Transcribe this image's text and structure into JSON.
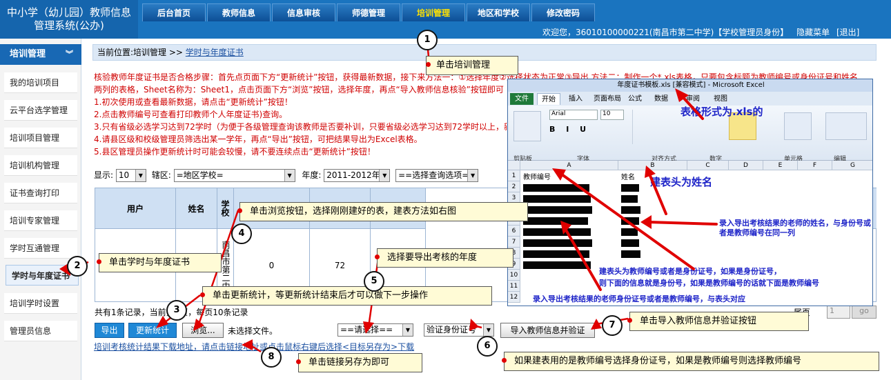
{
  "app": {
    "title_line1": "中小学（幼儿园）教师信息",
    "title_line2": "管理系统(公办)"
  },
  "nav": {
    "tabs": [
      {
        "label": "后台首页"
      },
      {
        "label": "教师信息"
      },
      {
        "label": "信息审核"
      },
      {
        "label": "师德管理"
      },
      {
        "label": "培训管理",
        "active": true
      },
      {
        "label": "地区和学校"
      },
      {
        "label": "修改密码"
      }
    ]
  },
  "welcome": {
    "text": "欢迎您，36010100000221(南昌市第二中学)【学校管理员身份】",
    "hide_menu": "隐藏菜单",
    "logout": "[退出]"
  },
  "sidebar": {
    "title": "培训管理",
    "items": [
      {
        "label": "我的培训项目"
      },
      {
        "label": "云平台选学管理"
      },
      {
        "label": "培训项目管理"
      },
      {
        "label": "培训机构管理"
      },
      {
        "label": "证书查询打印"
      },
      {
        "label": "培训专家管理"
      },
      {
        "label": "学时互通管理"
      },
      {
        "label": "学时与年度证书",
        "selected": true
      },
      {
        "label": "培训学时设置"
      },
      {
        "label": "管理员信息"
      }
    ]
  },
  "breadcrumb": {
    "prefix": "当前位置:培训管理 >> ",
    "link": "学时与年度证书"
  },
  "instructions": [
    "核验教师年度证书是否合格步骤：首先点页面下方“更新统计”按钮，获得最新数据，接下来方法一：①选择年度②选择状态为正常③导出 方法二：制作一个*.xls表格，只要包含标题为教师编号或身份证号和姓名",
    "两列的表格，Sheet名称为：Sheet1，点击页面下方“浏览”按钮，选择年度，再点“导入教师信息核验”按钮即可",
    "1.初次使用或查看最新数据，请点击“更新统计”按钮！",
    "2.点击教师编号可查看打印教师个人年度证书)查询。",
    "3.只有省级必选学习达到72学时（为便于各级管理查询该教师是否要补训，只要省级必选学习达到72学时以上，新",
    "4.请县区级和校级管理员筛选出某一学年，再点“导出”按钮，可把结果导出为Excel表格。",
    "5.县区管理员操作更新统计时可能会较慢，请不要连续点击“更新统计”按钮！"
  ],
  "filters": {
    "show_label": "显示:",
    "show_value": "10",
    "area_label": "辖区:",
    "area_value": "=地区学校=",
    "year_label": "年度:",
    "year_value": "2011-2012年度",
    "query_value": "==选择查询选项=="
  },
  "table": {
    "headers": [
      "用户",
      "姓名",
      "学校",
      "国",
      "省级培训学",
      "市级培训学",
      "核"
    ],
    "row": {
      "school": "南昌市第二中",
      "col4": "0",
      "col5": "72",
      "last": "格"
    }
  },
  "pager": {
    "text": "共有1条记录，当前第1页，每页10条记录",
    "last_label": "尾页",
    "page_value": "1",
    "go_label": "go"
  },
  "actions": {
    "export": "导出",
    "update_stats": "更新统计",
    "browse": "浏览...",
    "no_file": "未选择文件。",
    "year_select": "==请选择==",
    "id_select": "验证身份证号",
    "import_verify": "导入教师信息并验证"
  },
  "download_link": "培训考核统计结果下载地址，请点击链接地址或点击鼠标右键后选择<目标另存为>下载",
  "callouts": [
    {
      "n": "1",
      "text": "单击培训管理"
    },
    {
      "n": "2",
      "text": "单击学时与年度证书"
    },
    {
      "n": "3",
      "text": "单击更新统计，等更新统计结束后才可以做下一步操作"
    },
    {
      "n": "4",
      "text": "单击浏览按钮，选择刚刚建好的表，建表方法如右图"
    },
    {
      "n": "5",
      "text": "选择要导出考核的年度"
    },
    {
      "n": "6",
      "text": "如果建表用的是教师编号选择身份证号，如果是教师编号则选择教师编号"
    },
    {
      "n": "7",
      "text": "单击导入教师信息并验证按钮"
    },
    {
      "n": "8",
      "text": "单击链接另存为即可"
    }
  ],
  "excel": {
    "title": "年度证书模板.xls [兼容模式] - Microsoft Excel",
    "file_tab": "文件",
    "tabs": [
      "开始",
      "插入",
      "页面布局",
      "公式",
      "数据",
      "审阅",
      "视图"
    ],
    "font_name": "Arial",
    "font_size": "10",
    "groups": [
      "剪贴板",
      "字体",
      "对齐方式",
      "数字",
      "单元格",
      "编辑"
    ],
    "cell_a1": "教师编号",
    "cell_b1": "姓名",
    "columns": [
      "A",
      "B",
      "C",
      "D",
      "E",
      "F",
      "G"
    ],
    "rows": [
      "1",
      "2",
      "3",
      "4",
      "5",
      "6",
      "7",
      "8",
      "9",
      "10",
      "11",
      "12"
    ]
  },
  "notes": {
    "xls": "表格形式为.xls的",
    "name_header": "建表头为姓名",
    "name_col": "录入导出考核结果的老师的姓名，与身份号或者是教师编号在同一列",
    "id_header_1": "建表头为教师编号或者是身份证号，如果是身份证号，",
    "id_header_2": "则下面的信息就是身份号，如果是教师编号的话就下面是教师编号",
    "id_col": "录入导出考核结果的老师身份证号或者是教师编号，与表头对应"
  }
}
